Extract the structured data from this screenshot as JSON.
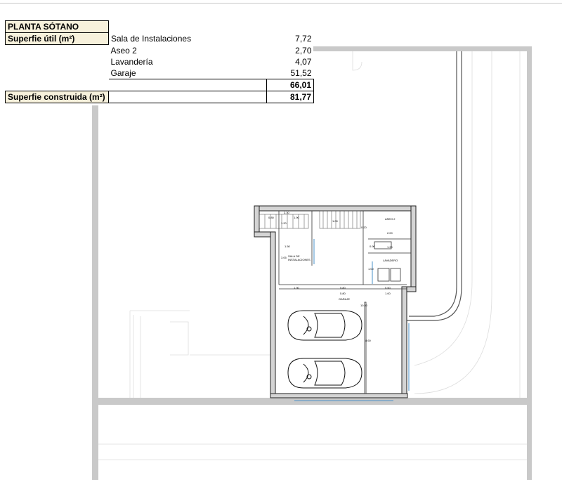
{
  "table": {
    "title": "PLANTA SÓTANO",
    "superficie_util_label": "Superfie útil (m²)",
    "rows": [
      {
        "name": "Sala de Instalaciones",
        "value": "7,72"
      },
      {
        "name": "Aseo 2",
        "value": "2,70"
      },
      {
        "name": "Lavandería",
        "value": "4,07"
      },
      {
        "name": "Garaje",
        "value": "51,52"
      }
    ],
    "subtotal": "66,01",
    "superficie_construida_label": "Superfie construida (m²)",
    "superficie_construida_value": "81,77"
  },
  "plan": {
    "rooms": {
      "aseo": "ASEO 2",
      "lavadero": "LAVADERO",
      "sala_line1": "SALA DE",
      "sala_line2": "INSTALACIONES",
      "garaje": "GARAJE"
    },
    "dims": {
      "d_230": "2.30",
      "d_080": "0.80",
      "d_190a": "1.90",
      "d_120a": "1.20",
      "d_020": "0.20",
      "d_100a": "1.00",
      "d_200": "2.00",
      "d_120b": "1.20",
      "d_090": "0.90",
      "d_150": "1.50",
      "d_305": "3.05",
      "d_100b": "1.00",
      "d_190b": "1.90",
      "d_580a": "5.80",
      "d_550": "5.50",
      "d_580b": "5.80",
      "d_100c": "1.00",
      "d_1000": "10.00",
      "d_860": "8.60"
    }
  }
}
